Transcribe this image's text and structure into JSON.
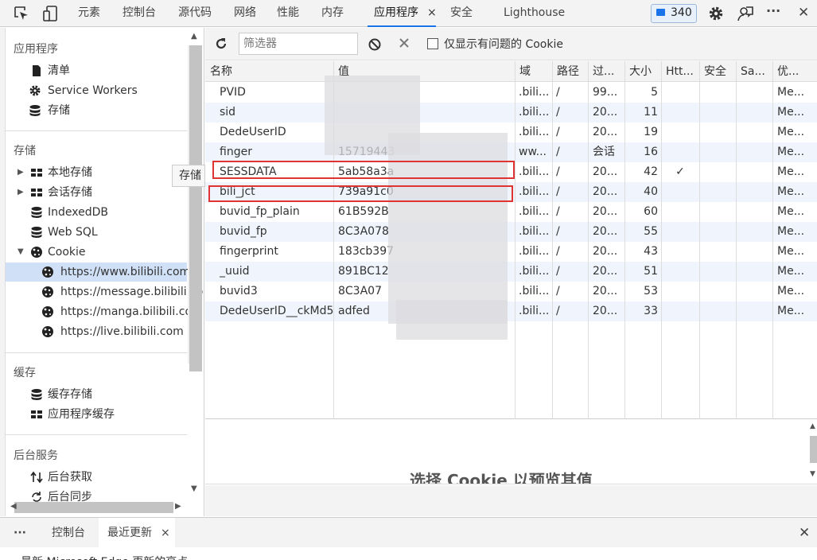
{
  "toolbar": {
    "tabs": [
      "元素",
      "控制台",
      "源代码",
      "网络",
      "性能",
      "内存",
      "应用程序",
      "安全",
      "Lighthouse"
    ],
    "close_glyph": "×",
    "issues_count": "340",
    "more_glyph": "···",
    "close_devtools_glyph": "✕"
  },
  "sidebar": {
    "sections": {
      "application": "应用程序",
      "storage": "存储",
      "cache": "缓存",
      "background": "后台服务"
    },
    "app_items": [
      "清单",
      "Service Workers",
      "存储"
    ],
    "storage_items": [
      "本地存储",
      "会话存储",
      "IndexedDB",
      "Web SQL",
      "Cookie"
    ],
    "cookie_sites": [
      "https://www.bilibili.com",
      "https://message.bilibili.com",
      "https://manga.bilibili.com",
      "https://live.bilibili.com"
    ],
    "cache_items": [
      "缓存存储",
      "应用程序缓存"
    ],
    "background_items": [
      "后台获取",
      "后台同步"
    ],
    "tooltip": "存储"
  },
  "filter": {
    "placeholder": "筛选器",
    "only_issues_label": "仅显示有问题的 Cookie"
  },
  "table": {
    "columns": [
      "名称",
      "值",
      "域",
      "路径",
      "过...",
      "大小",
      "Htt...",
      "安全",
      "Sa...",
      "优..."
    ],
    "rows": [
      {
        "name": "PVID",
        "value": "",
        "domain": ".bili...",
        "path": "/",
        "expires": "99...",
        "size": "5",
        "http": "",
        "priority": "Me..."
      },
      {
        "name": "sid",
        "value": "",
        "domain": ".bili...",
        "path": "/",
        "expires": "20...",
        "size": "11",
        "http": "",
        "priority": "Me..."
      },
      {
        "name": "DedeUserID",
        "value": "",
        "domain": ".bili...",
        "path": "/",
        "expires": "20...",
        "size": "19",
        "http": "",
        "priority": "Me..."
      },
      {
        "name": "finger",
        "value": "15719443",
        "domain": "ww...",
        "path": "/",
        "expires": "会话",
        "size": "16",
        "http": "",
        "priority": "Me..."
      },
      {
        "name": "SESSDATA",
        "value": "5ab58a3a",
        "domain": ".bili...",
        "path": "/",
        "expires": "20...",
        "size": "42",
        "http": "✓",
        "priority": "Me..."
      },
      {
        "name": "bili_jct",
        "value": "739a91c0",
        "domain": ".bili...",
        "path": "/",
        "expires": "20...",
        "size": "40",
        "http": "",
        "priority": "Me..."
      },
      {
        "name": "buvid_fp_plain",
        "value": "61B592B",
        "domain": ".bili...",
        "path": "/",
        "expires": "20...",
        "size": "60",
        "http": "",
        "priority": "Me..."
      },
      {
        "name": "buvid_fp",
        "value": "8C3A078",
        "domain": ".bili...",
        "path": "/",
        "expires": "20...",
        "size": "55",
        "http": "",
        "priority": "Me..."
      },
      {
        "name": "fingerprint",
        "value": "183cb397",
        "domain": ".bili...",
        "path": "/",
        "expires": "20...",
        "size": "43",
        "http": "",
        "priority": "Me..."
      },
      {
        "name": "_uuid",
        "value": "891BC12",
        "domain": ".bili...",
        "path": "/",
        "expires": "20...",
        "size": "51",
        "http": "",
        "priority": "Me..."
      },
      {
        "name": "buvid3",
        "value": "8C3A07",
        "domain": ".bili...",
        "path": "/",
        "expires": "20...",
        "size": "53",
        "http": "",
        "priority": "Me..."
      },
      {
        "name": "DedeUserID__ckMd5",
        "value": "adfed",
        "domain": ".bili...",
        "path": "/",
        "expires": "20...",
        "size": "33",
        "http": "",
        "priority": "Me..."
      }
    ]
  },
  "preview": {
    "message": "选择 Cookie 以预览其值"
  },
  "drawer": {
    "more_glyph": "···",
    "tabs": [
      "控制台",
      "最近更新"
    ],
    "close_glyph": "×",
    "close_drawer_glyph": "✕",
    "bottom_text": "最新 Microsoft Edge 更新的亮点"
  },
  "colors": {
    "accent": "#1a73e8",
    "highlight_box": "#e03434",
    "selected_bg": "#cfe0f7",
    "alt_row_bg": "#f0f5fd"
  }
}
